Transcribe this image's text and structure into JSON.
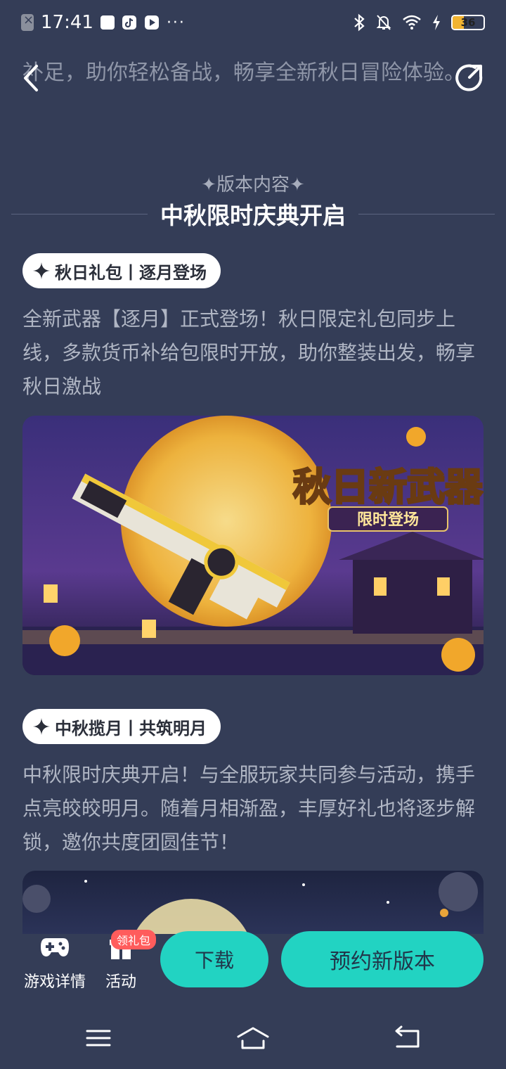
{
  "status_bar": {
    "time": "17:41",
    "battery": "36",
    "battery_color": "#f2b431",
    "icons": [
      "app-x-icon",
      "square-icon",
      "tiktok-icon",
      "play-icon",
      "more-dots-icon",
      "bluetooth-icon",
      "mute-bell-icon",
      "wifi-icon",
      "charging-icon",
      "battery-icon"
    ],
    "dots": "···"
  },
  "header": {
    "back_icon": "chevron-left-icon",
    "share_icon": "share-icon"
  },
  "intro": {
    "text": "补足，助你轻松备战，畅享全新秋日冒险体验。"
  },
  "section": {
    "subtitle": "✦版本内容✦",
    "title": "中秋限时庆典开启"
  },
  "blocks": [
    {
      "tag": "秋日礼包丨逐月登场",
      "text": "全新武器【逐月】正式登场！秋日限定礼包同步上线，多款货币补给包限时开放，助你整装出发，畅享秋日激战",
      "banner_title": "秋日新武器",
      "banner_subtitle": "限时登场"
    },
    {
      "tag": "中秋揽月丨共筑明月",
      "text": "中秋限时庆典开启！与全服玩家共同参与活动，携手点亮皎皎明月。随着月相渐盈，丰厚好礼也将逐步解锁，邀你共度团圆佳节！"
    }
  ],
  "action_bar": {
    "game_detail": "游戏详情",
    "activity": "活动",
    "gift_badge": "领礼包",
    "download": "下载",
    "reserve": "预约新版本",
    "accent": "#22d3c2"
  },
  "nav": {
    "icons": [
      "menu-icon",
      "home-icon",
      "back-icon"
    ]
  }
}
